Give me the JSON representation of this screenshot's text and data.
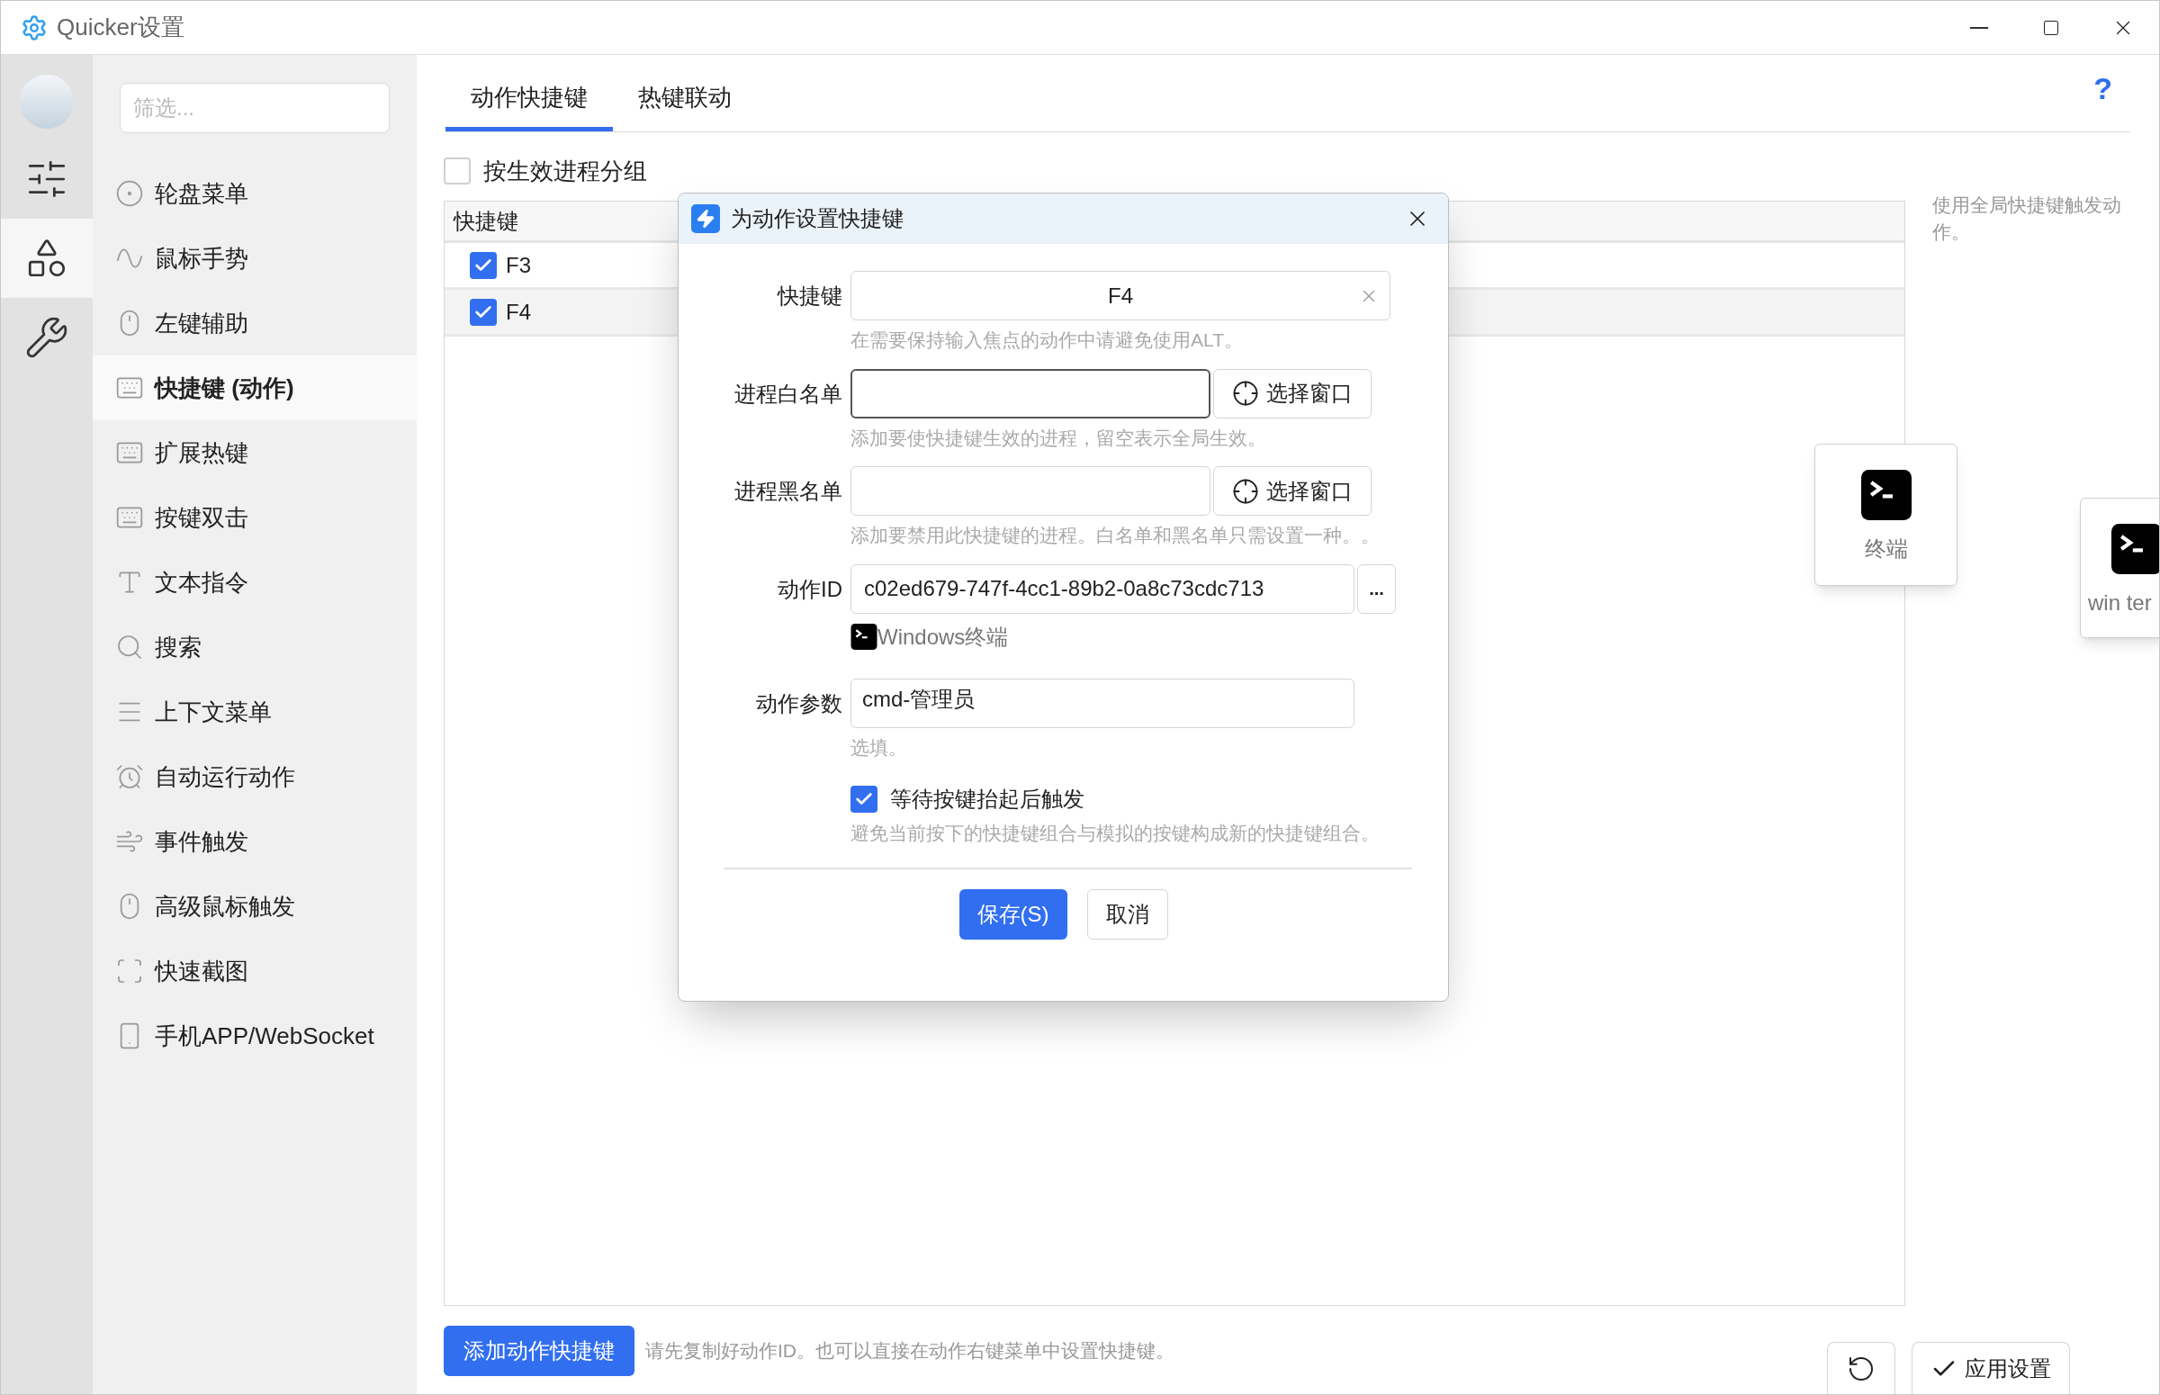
{
  "window": {
    "title": "Quicker设置"
  },
  "rail": [
    {
      "kind": "sliders",
      "selected": false
    },
    {
      "kind": "shapes",
      "selected": true
    },
    {
      "kind": "tools",
      "selected": false
    }
  ],
  "nav": {
    "filter_placeholder": "筛选...",
    "items": [
      {
        "kind": "wheel",
        "label": "轮盘菜单",
        "selected": false
      },
      {
        "kind": "gesture",
        "label": "鼠标手势",
        "selected": false
      },
      {
        "kind": "mouse",
        "label": "左键辅助",
        "selected": false
      },
      {
        "kind": "keyboard",
        "label": "快捷键 (动作)",
        "selected": true
      },
      {
        "kind": "keyboard",
        "label": "扩展热键",
        "selected": false
      },
      {
        "kind": "keyboard",
        "label": "按键双击",
        "selected": false
      },
      {
        "kind": "text",
        "label": "文本指令",
        "selected": false
      },
      {
        "kind": "search",
        "label": "搜索",
        "selected": false
      },
      {
        "kind": "menu",
        "label": "上下文菜单",
        "selected": false
      },
      {
        "kind": "alarm",
        "label": "自动运行动作",
        "selected": false
      },
      {
        "kind": "wind",
        "label": "事件触发",
        "selected": false
      },
      {
        "kind": "mouse",
        "label": "高级鼠标触发",
        "selected": false
      },
      {
        "kind": "capture",
        "label": "快速截图",
        "selected": false
      },
      {
        "kind": "phone",
        "label": "手机APP/WebSocket",
        "selected": false
      }
    ]
  },
  "tabs": [
    {
      "label": "动作快捷键",
      "selected": true
    },
    {
      "label": "热键联动",
      "selected": false
    }
  ],
  "help": "?",
  "group_by_process": {
    "label": "按生效进程分组",
    "checked": false
  },
  "table": {
    "columns": [
      "快捷键"
    ],
    "rows": [
      {
        "key": "F3",
        "checked": true,
        "selected": false
      },
      {
        "key": "F4",
        "checked": true,
        "selected": true
      }
    ]
  },
  "side_note": "使用全局快捷键触发动作。",
  "drag_cards": [
    {
      "label": "终端"
    },
    {
      "label": "win ter"
    }
  ],
  "dialog": {
    "title": "为动作设置快捷键",
    "fields": [
      {
        "kind": "hotkey",
        "label": "快捷键",
        "value": "F4",
        "hint": "在需要保持输入焦点的动作中请避免使用ALT。"
      },
      {
        "kind": "process",
        "label": "进程白名单",
        "button": "选择窗口",
        "focused": true,
        "hint": "添加要使快捷键生效的进程，留空表示全局生效。"
      },
      {
        "kind": "process",
        "label": "进程黑名单",
        "button": "选择窗口",
        "focused": false,
        "hint": "添加要禁用此快捷键的进程。白名单和黑名单只需设置一种。。"
      },
      {
        "kind": "action",
        "label": "动作ID",
        "value": "c02ed679-747f-4cc1-89b2-0a8c73cdc713",
        "button": "...",
        "action_name": "Windows终端"
      },
      {
        "kind": "text",
        "label": "动作参数",
        "value": "cmd-管理员",
        "hint": "选填。"
      }
    ],
    "wait_release": {
      "label": "等待按键抬起后触发",
      "checked": true,
      "hint": "避免当前按下的快捷键组合与模拟的按键构成新的快捷键组合。"
    },
    "buttons": [
      {
        "kind": "primary",
        "label": "保存(S)"
      },
      {
        "kind": "secondary",
        "label": "取消"
      }
    ]
  },
  "footer": {
    "add_button": "添加动作快捷键",
    "hint": "请先复制好动作ID。也可以直接在动作右键菜单中设置快捷键。",
    "apply_button": "应用设置"
  }
}
